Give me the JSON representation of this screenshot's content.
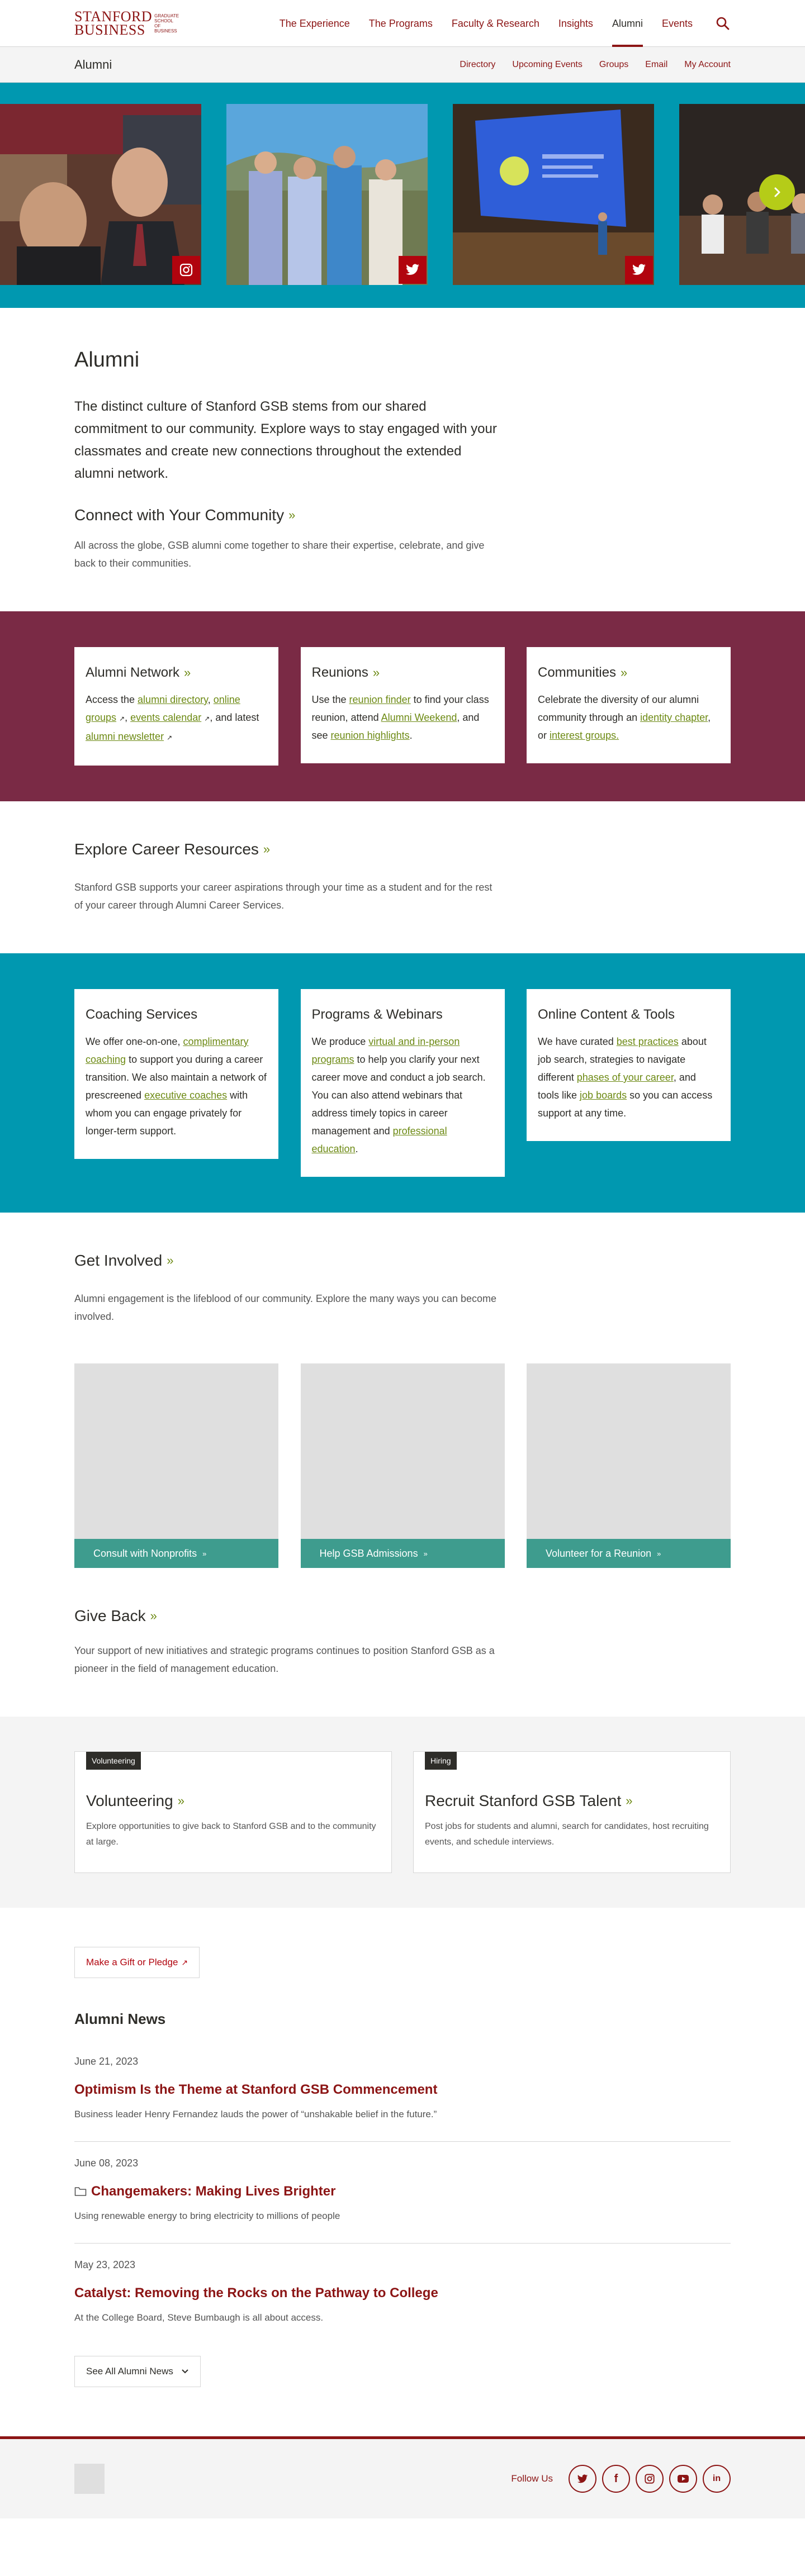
{
  "header": {
    "logo_main_line1": "STANFORD",
    "logo_main_line2": "BUSINESS",
    "logo_side": "GRADUATE SCHOOL OF BUSINESS",
    "nav": [
      {
        "label": "The Experience"
      },
      {
        "label": "The Programs"
      },
      {
        "label": "Faculty & Research"
      },
      {
        "label": "Insights"
      },
      {
        "label": "Alumni",
        "active": true
      },
      {
        "label": "Events"
      }
    ],
    "search_icon": "search-icon"
  },
  "subnav": {
    "title": "Alumni",
    "links": [
      "Directory",
      "Upcoming Events",
      "Groups",
      "Email",
      "My Account"
    ]
  },
  "carousel": {
    "slides": [
      {
        "social": "instagram-icon"
      },
      {
        "social": "twitter-icon"
      },
      {
        "social": "twitter-icon"
      },
      {
        "social": ""
      }
    ],
    "next_icon": "chevron-right-icon"
  },
  "intro": {
    "heading": "Alumni",
    "lede": "The distinct culture of Stanford GSB stems from our shared commitment to our community. Explore ways to stay engaged with your classmates and create new connections throughout the extended alumni network.",
    "connect_title": "Connect with Your Community",
    "connect_text": "All across the globe, GSB alumni come together to share their expertise, celebrate, and give back to their communities."
  },
  "community_cards": [
    {
      "title": "Alumni Network",
      "parts": [
        "Access the ",
        "alumni directory",
        ", ",
        "online groups",
        " ",
        ", ",
        "events calendar",
        " ",
        ", and latest ",
        "alumni newsletter",
        " "
      ]
    },
    {
      "title": "Reunions",
      "parts": [
        "Use the ",
        "reunion finder",
        " to find your class reunion, attend ",
        "Alumni Weekend",
        ", and see ",
        "reunion highlights",
        "."
      ]
    },
    {
      "title": "Communities",
      "parts": [
        "Celebrate the diversity of our alumni community through an ",
        "identity chapter",
        ", or ",
        "interest groups."
      ]
    }
  ],
  "career": {
    "title": "Explore Career Resources",
    "text": "Stanford GSB supports your career aspirations through your time as a student and for the rest of your career through Alumni Career Services."
  },
  "career_cards": [
    {
      "title": "Coaching Services",
      "parts": [
        "We offer one-on-one, ",
        "complimentary coaching",
        " to support you during a career transition. We also maintain a network of prescreened ",
        "executive coaches",
        " with whom you can engage privately for longer-term support."
      ]
    },
    {
      "title": "Programs & Webinars",
      "parts": [
        "We produce ",
        "virtual and in-person programs",
        " to help you clarify your next career move and conduct a job search. You can also attend webinars that address timely topics in career management and ",
        "professional education",
        "."
      ]
    },
    {
      "title": "Online Content & Tools",
      "parts": [
        "We have curated ",
        "best practices",
        " about job search, strategies to navigate different ",
        "phases of your career",
        ", and tools like ",
        "job boards",
        " so you can access support at any time."
      ]
    }
  ],
  "involved": {
    "title": "Get Involved",
    "text": "Alumni engagement is the lifeblood of our community. Explore the many ways you can become involved.",
    "tiles": [
      "Consult with Nonprofits",
      "Help GSB Admissions",
      "Volunteer for a Reunion"
    ]
  },
  "giveback": {
    "title": "Give Back",
    "text": "Your support of new initiatives and strategic programs continues to position Stanford GSB as a pioneer in the field of management education."
  },
  "promos": [
    {
      "tag": "Volunteering",
      "title": "Volunteering",
      "text": "Explore opportunities to give back to Stanford GSB and to the community at large."
    },
    {
      "tag": "Hiring",
      "title": "Recruit Stanford GSB Talent",
      "text": "Post jobs for students and alumni, search for candidates, host recruiting events, and schedule interviews."
    }
  ],
  "news": {
    "gift_label": "Make a Gift or Pledge",
    "heading": "Alumni News",
    "items": [
      {
        "date": "June 21, 2023",
        "title": "Optimism Is the Theme at Stanford GSB Commencement",
        "desc": "Business leader Henry Fernandez lauds the power of “unshakable belief in the future.”",
        "icon": ""
      },
      {
        "date": "June 08, 2023",
        "title": "Changemakers: Making Lives Brighter",
        "desc": "Using renewable energy to bring electricity to millions of people",
        "icon": "folder-icon"
      },
      {
        "date": "May 23, 2023",
        "title": "Catalyst: Removing the Rocks on the Pathway to College",
        "desc": "At the College Board, Steve Bumbaugh is all about access.",
        "icon": ""
      }
    ],
    "see_all": "See All Alumni News"
  },
  "footer": {
    "follow_label": "Follow Us",
    "social": [
      "twitter-icon",
      "facebook-icon",
      "instagram-icon",
      "youtube-icon",
      "linkedin-icon"
    ]
  },
  "colors": {
    "brand": "#8c1515",
    "teal": "#0098b0",
    "maroon_band": "#7a2a45",
    "link_green": "#6d8a14",
    "button_green": "#3e9c8e",
    "next_button": "#b5cc18"
  }
}
